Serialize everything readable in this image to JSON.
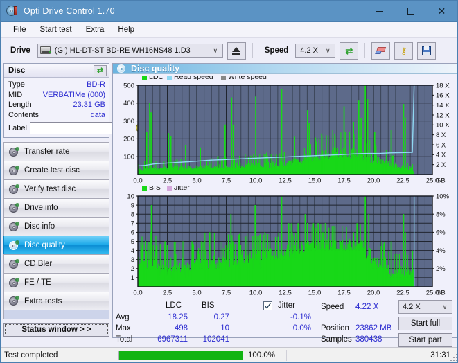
{
  "window": {
    "title": "Opti Drive Control 1.70",
    "icon": "disc-icon",
    "minimize": "—",
    "maximize": "□",
    "close": "✕"
  },
  "menubar": [
    {
      "label": "File",
      "name": "menu-file"
    },
    {
      "label": "Start test",
      "name": "menu-start-test"
    },
    {
      "label": "Extra",
      "name": "menu-extra"
    },
    {
      "label": "Help",
      "name": "menu-help"
    }
  ],
  "toolbar": {
    "drive_label": "Drive",
    "drive_value": "(G:)  HL-DT-ST BD-RE  WH16NS48 1.D3",
    "speed_label": "Speed",
    "speed_value": "4.2 X",
    "arrow": "∨",
    "buttons": [
      {
        "name": "eject-button",
        "icon": "eject-icon"
      },
      {
        "name": "refresh-button",
        "icon": "refresh-icon"
      },
      {
        "name": "erase-button",
        "icon": "eraser-icon"
      },
      {
        "name": "key-button",
        "icon": "key-icon"
      },
      {
        "name": "save-button",
        "icon": "floppy-save-icon"
      }
    ]
  },
  "disc_panel": {
    "title": "Disc",
    "refresh_icon": "refresh-icon",
    "rows": [
      {
        "key": "Type",
        "value": "BD-R"
      },
      {
        "key": "MID",
        "value": "VERBATIMe (000)"
      },
      {
        "key": "Length",
        "value": "23.31 GB"
      },
      {
        "key": "Contents",
        "value": "data"
      }
    ],
    "label_key": "Label",
    "label_value": "",
    "label_placeholder": "",
    "label_button_icon": "disc-icon"
  },
  "nav": {
    "items": [
      {
        "label": "Transfer rate",
        "name": "sidebar-item-transfer-rate",
        "active": false
      },
      {
        "label": "Create test disc",
        "name": "sidebar-item-create-test-disc",
        "active": false
      },
      {
        "label": "Verify test disc",
        "name": "sidebar-item-verify-test-disc",
        "active": false
      },
      {
        "label": "Drive info",
        "name": "sidebar-item-drive-info",
        "active": false
      },
      {
        "label": "Disc info",
        "name": "sidebar-item-disc-info",
        "active": false
      },
      {
        "label": "Disc quality",
        "name": "sidebar-item-disc-quality",
        "active": true
      },
      {
        "label": "CD Bler",
        "name": "sidebar-item-cd-bler",
        "active": false
      },
      {
        "label": "FE / TE",
        "name": "sidebar-item-fe-te",
        "active": false
      },
      {
        "label": "Extra tests",
        "name": "sidebar-item-extra-tests",
        "active": false
      }
    ],
    "status_window_button": "Status window > >"
  },
  "content": {
    "title": "Disc quality",
    "icon": "disc-quality-icon"
  },
  "stats": {
    "headers": {
      "ldc": "LDC",
      "bis": "BIS"
    },
    "rows": [
      {
        "label": "Avg",
        "ldc": "18.25",
        "bis": "0.27",
        "jitter": "-0.1%"
      },
      {
        "label": "Max",
        "ldc": "498",
        "bis": "10",
        "jitter": "0.0%"
      },
      {
        "label": "Total",
        "ldc": "6967311",
        "bis": "102041",
        "jitter": ""
      }
    ],
    "jitter_label": "Jitter",
    "jitter_checked": true,
    "speed_label": "Speed",
    "speed_value": "4.22 X",
    "position_label": "Position",
    "position_value": "23862 MB",
    "samples_label": "Samples",
    "samples_value": "380438",
    "speed_select": "4.2 X",
    "arrow": "∨",
    "start_full": "Start full",
    "start_part": "Start part"
  },
  "statusbar": {
    "text": "Test completed",
    "percent_label": "100.0%",
    "percent": 100,
    "time": "31:31"
  },
  "colors": {
    "accent": "#5b93c4",
    "plot_bg": "#5d6a8a",
    "series_green": "#18d818",
    "series_read_speed": "#8fd8f2",
    "series_write_speed": "#f57ae0",
    "series_jitter": "#d5a8dc",
    "value_blue": "#2b2bd0",
    "progress_green": "#12b412",
    "nav_active": "#17a6e8"
  },
  "chart_data": [
    {
      "type": "area",
      "name": "ldc-chart",
      "title": "",
      "xlabel": "GB",
      "ylabel": "",
      "xlim": [
        0,
        25
      ],
      "ylim": [
        0,
        500
      ],
      "y2lim": [
        0,
        18
      ],
      "y2label": "X",
      "xticks": [
        "0.0",
        "2.5",
        "5.0",
        "7.5",
        "10.0",
        "12.5",
        "15.0",
        "17.5",
        "20.0",
        "22.5",
        "25.0"
      ],
      "yticks": [
        "100",
        "200",
        "300",
        "400",
        "500"
      ],
      "y2ticks": [
        "2 X",
        "4 X",
        "6 X",
        "8 X",
        "10 X",
        "12 X",
        "14 X",
        "16 X",
        "18 X"
      ],
      "grid": true,
      "legend": [
        "LDC",
        "Read speed",
        "Write speed"
      ],
      "legend_position": "top-left",
      "series": [
        {
          "name": "LDC",
          "color": "#18d818",
          "type": "area",
          "baseline": [
            18,
            20,
            22,
            19,
            24,
            21,
            26,
            23,
            20,
            25,
            22,
            28,
            24,
            21,
            26,
            23,
            27,
            22,
            25,
            24,
            26,
            23,
            28,
            25,
            22,
            27,
            24,
            29,
            26,
            23,
            28,
            25,
            30,
            27,
            24,
            29,
            26,
            31,
            28,
            25,
            30,
            27,
            32,
            29,
            26,
            31,
            28,
            33,
            30,
            27,
            32,
            29,
            34,
            31,
            28,
            33,
            30,
            35,
            32,
            29,
            34,
            31,
            36,
            33,
            30,
            35,
            32,
            37,
            34,
            31,
            36,
            33,
            38,
            35,
            32,
            37,
            34,
            39,
            36,
            33,
            38,
            35,
            40,
            37,
            34,
            39,
            36,
            41,
            38,
            35,
            40,
            37,
            42,
            39,
            36,
            41,
            38,
            43,
            40,
            37,
            44,
            41,
            46,
            43,
            40,
            48,
            45,
            50,
            47,
            44,
            52,
            49,
            55,
            52,
            49,
            58,
            55,
            62,
            59,
            56,
            65,
            62,
            70,
            67,
            64,
            73,
            70,
            76,
            73,
            70,
            80,
            77,
            84,
            81,
            78,
            86,
            83,
            88,
            85,
            82,
            90,
            87,
            92,
            89,
            86,
            94,
            91,
            96,
            93,
            90,
            95,
            92,
            90,
            87,
            84,
            88,
            85,
            82,
            79,
            76,
            80,
            77,
            74,
            71,
            68,
            72,
            69,
            66,
            63,
            60,
            64,
            61,
            58,
            55,
            52,
            56,
            53,
            50,
            47,
            44,
            48,
            45,
            42,
            39,
            36,
            40,
            37,
            34,
            31,
            28,
            32,
            29,
            26,
            23,
            20,
            24,
            21,
            18,
            16,
            14
          ],
          "spikes": [
            {
              "x": 1.0,
              "y": 403
            },
            {
              "x": 1.12,
              "y": 348
            },
            {
              "x": 0.75,
              "y": 240
            },
            {
              "x": 2.6,
              "y": 232
            },
            {
              "x": 2.8,
              "y": 213
            },
            {
              "x": 4.05,
              "y": 163
            },
            {
              "x": 5.3,
              "y": 152
            },
            {
              "x": 7.4,
              "y": 280
            },
            {
              "x": 7.95,
              "y": 432
            },
            {
              "x": 8.1,
              "y": 280
            },
            {
              "x": 10.0,
              "y": 437
            },
            {
              "x": 12.2,
              "y": 477
            },
            {
              "x": 13.3,
              "y": 212
            },
            {
              "x": 14.4,
              "y": 360
            },
            {
              "x": 14.55,
              "y": 290
            },
            {
              "x": 15.6,
              "y": 230
            },
            {
              "x": 17.5,
              "y": 382
            },
            {
              "x": 18.3,
              "y": 295
            },
            {
              "x": 18.75,
              "y": 414
            },
            {
              "x": 18.95,
              "y": 318
            },
            {
              "x": 19.3,
              "y": 500
            },
            {
              "x": 19.5,
              "y": 422
            },
            {
              "x": 20.1,
              "y": 237
            },
            {
              "x": 21.5,
              "y": 250
            },
            {
              "x": 22.55,
              "y": 395
            },
            {
              "x": 22.7,
              "y": 320
            }
          ]
        },
        {
          "name": "Read speed",
          "color": "#8fd8f2",
          "type": "line",
          "axis": "y2",
          "points": [
            [
              0.0,
              1.75
            ],
            [
              0.6,
              1.85
            ],
            [
              1.4,
              2.15
            ],
            [
              2.4,
              2.3
            ],
            [
              3.4,
              2.45
            ],
            [
              4.4,
              2.6
            ],
            [
              5.3,
              2.75
            ],
            [
              6.2,
              2.9
            ],
            [
              7.2,
              3.0
            ],
            [
              8.1,
              3.1
            ],
            [
              9.0,
              3.2
            ],
            [
              10.0,
              3.3
            ],
            [
              11.0,
              3.4
            ],
            [
              12.0,
              3.5
            ],
            [
              13.0,
              3.6
            ],
            [
              14.0,
              3.7
            ],
            [
              15.0,
              3.8
            ],
            [
              16.0,
              3.9
            ],
            [
              17.2,
              4.0
            ],
            [
              18.3,
              4.15
            ],
            [
              19.4,
              4.25
            ],
            [
              20.5,
              4.25
            ],
            [
              21.4,
              4.35
            ],
            [
              22.4,
              4.4
            ],
            [
              23.3,
              4.45
            ],
            [
              23.45,
              18.0
            ]
          ]
        }
      ]
    },
    {
      "type": "area",
      "name": "bis-chart",
      "title": "",
      "xlabel": "GB",
      "ylabel": "",
      "xlim": [
        0,
        25
      ],
      "ylim": [
        0,
        10
      ],
      "y2lim": [
        0,
        10
      ],
      "y2label": "%",
      "xticks": [
        "0.0",
        "2.5",
        "5.0",
        "7.5",
        "10.0",
        "12.5",
        "15.0",
        "17.5",
        "20.0",
        "22.5",
        "25.0"
      ],
      "yticks": [
        "1",
        "2",
        "3",
        "4",
        "5",
        "6",
        "7",
        "8",
        "9",
        "10"
      ],
      "y2ticks": [
        "2%",
        "4%",
        "6%",
        "8%",
        "10%"
      ],
      "grid": true,
      "legend": [
        "BIS",
        "Jitter"
      ],
      "legend_position": "top-left",
      "series": [
        {
          "name": "BIS",
          "color": "#18d818",
          "type": "area",
          "baseline": [
            2,
            2,
            3,
            2,
            2,
            3,
            2,
            2,
            2,
            3,
            2,
            2,
            3,
            2,
            2,
            2,
            1,
            2,
            1,
            2,
            2,
            1,
            2,
            2,
            1,
            2,
            2,
            1,
            2,
            2,
            1,
            2,
            2,
            2,
            1,
            2,
            2,
            1,
            2,
            2,
            2,
            2,
            2,
            3,
            2,
            2,
            2,
            2,
            3,
            2,
            2,
            2,
            2,
            2,
            3,
            2,
            2,
            2,
            2,
            2,
            2,
            3,
            2,
            2,
            3,
            2,
            2,
            3,
            2,
            2,
            3,
            2,
            3,
            2,
            3,
            3,
            2,
            3,
            3,
            2,
            3,
            3,
            3,
            2,
            3,
            3,
            3,
            3,
            2,
            3,
            3,
            3,
            3,
            3,
            3,
            3,
            3,
            3,
            3,
            3,
            3,
            3,
            3,
            3,
            3,
            3,
            3,
            4,
            3,
            3,
            4,
            3,
            4,
            3,
            4,
            4,
            3,
            4,
            4,
            3,
            4,
            4,
            4,
            4,
            4,
            4,
            4,
            4,
            4,
            4,
            4,
            4,
            4,
            4,
            4,
            4,
            4,
            4,
            4,
            4,
            4,
            4,
            4,
            4,
            4,
            4,
            4,
            4,
            4,
            4,
            4,
            4,
            4,
            4,
            4,
            4,
            4,
            4,
            4,
            4,
            4,
            4,
            4,
            3,
            3,
            3,
            3,
            3,
            2,
            2,
            2,
            2,
            2,
            2,
            2,
            2,
            2,
            2,
            2,
            2,
            1,
            1,
            1,
            1,
            1,
            1,
            1,
            1,
            1,
            1,
            1,
            1,
            1,
            1,
            1,
            1,
            1,
            1,
            1,
            1
          ],
          "spikes": [
            {
              "x": 0.4,
              "y": 3
            },
            {
              "x": 1.15,
              "y": 9
            },
            {
              "x": 2.3,
              "y": 5
            },
            {
              "x": 4.6,
              "y": 5
            },
            {
              "x": 6.1,
              "y": 6
            },
            {
              "x": 7.9,
              "y": 8
            },
            {
              "x": 8.05,
              "y": 5
            },
            {
              "x": 9.95,
              "y": 9
            },
            {
              "x": 10.6,
              "y": 5
            },
            {
              "x": 11.2,
              "y": 5
            },
            {
              "x": 12.2,
              "y": 10
            },
            {
              "x": 12.8,
              "y": 7
            },
            {
              "x": 13.1,
              "y": 6
            },
            {
              "x": 13.6,
              "y": 7
            },
            {
              "x": 14.2,
              "y": 8
            },
            {
              "x": 14.4,
              "y": 7
            },
            {
              "x": 14.9,
              "y": 7
            },
            {
              "x": 15.3,
              "y": 7
            },
            {
              "x": 15.7,
              "y": 6
            },
            {
              "x": 16.6,
              "y": 5
            },
            {
              "x": 17.2,
              "y": 5
            },
            {
              "x": 17.9,
              "y": 5
            },
            {
              "x": 18.3,
              "y": 6
            },
            {
              "x": 18.6,
              "y": 7
            },
            {
              "x": 19.3,
              "y": 10
            },
            {
              "x": 19.6,
              "y": 8
            },
            {
              "x": 21.5,
              "y": 5
            },
            {
              "x": 22.55,
              "y": 8
            },
            {
              "x": 22.7,
              "y": 6
            }
          ]
        },
        {
          "name": "Jitter",
          "color": "#d5a8dc",
          "type": "line",
          "axis": "y2",
          "points": []
        },
        {
          "name": "Read speed marker",
          "color": "#8fd8f2",
          "type": "line",
          "points": [
            [
              23.45,
              0
            ],
            [
              23.45,
              10
            ]
          ]
        }
      ]
    }
  ]
}
